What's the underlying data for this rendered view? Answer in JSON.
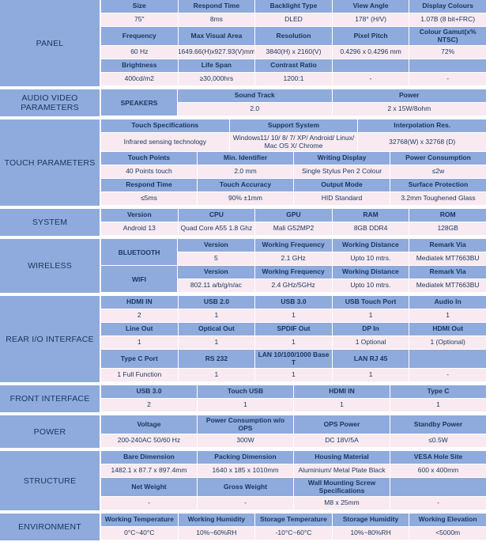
{
  "document": {
    "title": "Display Product Specification Sheet",
    "accent_header_color": "#8FAADC",
    "data_row_color": "#F8EAF0",
    "text_color": "#17375E"
  },
  "sections": [
    {
      "category": "PANEL",
      "rows": [
        {
          "type": "head",
          "cells": [
            "Size",
            "Respond Time",
            "Backlight Type",
            "View Angle",
            "Display Colours"
          ]
        },
        {
          "type": "data",
          "cells": [
            "75\"",
            "8ms",
            "DLED",
            "178° (H/V)",
            "1.07B (8 bit+FRC)"
          ]
        },
        {
          "type": "head",
          "cells": [
            "Frequency",
            "Max Visual Area",
            "Resolution",
            "Pixel Pitch",
            "Colour Gamut(x% NTSC)"
          ]
        },
        {
          "type": "data",
          "cells": [
            "60 Hz",
            "1649.66(H)x927.93(V)mm",
            "3840(H) x 2160(V)",
            "0.4296 x 0.4296 mm",
            "72%"
          ]
        },
        {
          "type": "head",
          "cells": [
            "Brightness",
            "Life Span",
            "Contrast Ratio",
            "",
            ""
          ]
        },
        {
          "type": "data",
          "cells": [
            "400cd/m2",
            "≥30,000hrs",
            "1200:1",
            "-",
            "-"
          ]
        }
      ]
    },
    {
      "category": "AUDIO VIDEO PARAMETERS",
      "subcategory": "SPEAKERS",
      "rows": [
        {
          "type": "head",
          "cells": [
            "Sound Track",
            "Power"
          ]
        },
        {
          "type": "data",
          "cells": [
            "2.0",
            "2 x 15W/8ohm"
          ]
        }
      ]
    },
    {
      "category": "TOUCH PARAMETERS",
      "rows": [
        {
          "type": "head",
          "cells": [
            "Touch Specifications",
            "Support System",
            "Interpolation Res."
          ]
        },
        {
          "type": "data",
          "cells": [
            "Infrared sensing technology",
            "Windows11/ 10/ 8/ 7/ XP/ Android/ Linux/ Mac OS X/ Chrome",
            "32768(W) x 32768 (D)"
          ]
        },
        {
          "type": "head",
          "cells": [
            "Touch Points",
            "Min. Identifier",
            "Writing Display",
            "Power Consumption"
          ]
        },
        {
          "type": "data",
          "cells": [
            "40 Points touch",
            "2.0 mm",
            "Single Stylus Pen 2 Colour",
            "≤2w"
          ]
        },
        {
          "type": "head",
          "cells": [
            "Respond Time",
            "Touch Accuracy",
            "Output Mode",
            "Surface Protection"
          ]
        },
        {
          "type": "data",
          "cells": [
            "≤5ms",
            "90% ±1mm",
            "HID Standard",
            "3.2mm Toughened Glass"
          ]
        }
      ]
    },
    {
      "category": "SYSTEM",
      "rows": [
        {
          "type": "head",
          "cells": [
            "Version",
            "CPU",
            "GPU",
            "RAM",
            "ROM"
          ]
        },
        {
          "type": "data",
          "cells": [
            "Android 13",
            "Quad Core A55 1.8 Ghz",
            "Mali G52MP2",
            "8GB DDR4",
            "128GB"
          ]
        }
      ]
    },
    {
      "category": "WIRELESS",
      "subgroups": [
        {
          "subcategory": "BLUETOOTH",
          "rows": [
            {
              "type": "head",
              "cells": [
                "Version",
                "Working Frequency",
                "Working Distance",
                "Remark Via"
              ]
            },
            {
              "type": "data",
              "cells": [
                "5",
                "2.1 GHz",
                "Upto 10 mtrs.",
                "Mediatek MT7663BU"
              ]
            }
          ]
        },
        {
          "subcategory": "WIFI",
          "rows": [
            {
              "type": "head",
              "cells": [
                "Version",
                "Working Frequency",
                "Working Distance",
                "Remark Via"
              ]
            },
            {
              "type": "data",
              "cells": [
                "802.11 a/b/g/n/ac",
                "2.4 GHz/5GHz",
                "Upto 10 mtrs.",
                "Mediatek MT7663BU"
              ]
            }
          ]
        }
      ]
    },
    {
      "category": "REAR I/O INTERFACE",
      "rows": [
        {
          "type": "head",
          "cells": [
            "HDMI IN",
            "USB 2.0",
            "USB 3.0",
            "USB Touch Port",
            "Audio In"
          ]
        },
        {
          "type": "data",
          "cells": [
            "2",
            "1",
            "1",
            "1",
            "1"
          ]
        },
        {
          "type": "head",
          "cells": [
            "Line Out",
            "Optical Out",
            "SPDIF Out",
            "DP In",
            "HDMI Out"
          ]
        },
        {
          "type": "data",
          "cells": [
            "1",
            "1",
            "1",
            "1 Optional",
            "1 (Optional)"
          ]
        },
        {
          "type": "head",
          "cells": [
            "Type C Port",
            "RS 232",
            "LAN 10/100/1000 Base T",
            "LAN RJ 45",
            ""
          ]
        },
        {
          "type": "data",
          "cells": [
            "1 Full Function",
            "1",
            "1",
            "1",
            "-"
          ]
        }
      ]
    },
    {
      "category": "FRONT INTERFACE",
      "rows": [
        {
          "type": "head",
          "cells": [
            "USB 3.0",
            "Touch USB",
            "HDMI IN",
            "Type C"
          ]
        },
        {
          "type": "data",
          "cells": [
            "2",
            "1",
            "1",
            "1"
          ]
        }
      ]
    },
    {
      "category": "POWER",
      "rows": [
        {
          "type": "head",
          "cells": [
            "Voltage",
            "Power Consumption w/o OPS",
            "OPS Power",
            "Standby Power"
          ]
        },
        {
          "type": "data",
          "cells": [
            "200-240AC 50/60 Hz",
            "300W",
            "DC 18V/5A",
            "≤0.5W"
          ]
        }
      ]
    },
    {
      "category": "STRUCTURE",
      "rows": [
        {
          "type": "head",
          "cells": [
            "Bare Dimension",
            "Packing Dimension",
            "Housing Material",
            "VESA Hole Site"
          ]
        },
        {
          "type": "data",
          "cells": [
            "1482.1 x 87.7 x 897.4mm",
            "1640 x 185 x 1010mm",
            "Aluminium/ Metal Plate Black",
            "600 x 400mm"
          ]
        },
        {
          "type": "head",
          "cells": [
            "Net Weight",
            "Gross Weight",
            "Wall Mounting Screw Specifications",
            ""
          ]
        },
        {
          "type": "data",
          "cells": [
            "-",
            "-",
            "M8 x 25mm",
            "-"
          ]
        }
      ]
    },
    {
      "category": "ENVIRONMENT",
      "rows": [
        {
          "type": "head",
          "cells": [
            "Working Temperature",
            "Working Humidity",
            "Storage Temperature",
            "Storage Humidity",
            "Working Elevation"
          ]
        },
        {
          "type": "data",
          "cells": [
            "0°C~40°C",
            "10%~60%RH",
            "-10°C~60°C",
            "10%~80%RH",
            "<5000m"
          ]
        }
      ]
    }
  ]
}
